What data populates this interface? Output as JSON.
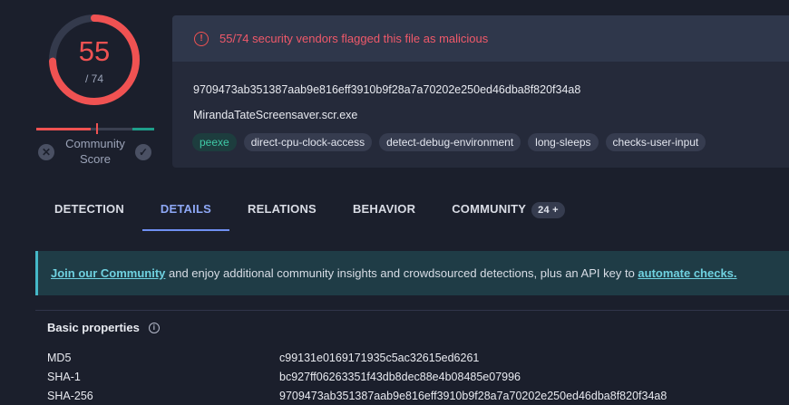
{
  "score": {
    "detections": "55",
    "total": "/ 74",
    "community_label": "Community Score"
  },
  "alert": {
    "text": "55/74 security vendors flagged this file as malicious"
  },
  "file": {
    "hash": "9709473ab351387aab9e816eff3910b9f28a7a70202e250ed46dba8f820f34a8",
    "name": "MirandaTateScreensaver.scr.exe",
    "tags": [
      "peexe",
      "direct-cpu-clock-access",
      "detect-debug-environment",
      "long-sleeps",
      "checks-user-input"
    ]
  },
  "tabs": [
    {
      "label": "DETECTION"
    },
    {
      "label": "DETAILS"
    },
    {
      "label": "RELATIONS"
    },
    {
      "label": "BEHAVIOR"
    },
    {
      "label": "COMMUNITY"
    }
  ],
  "community_badge": "24 +",
  "banner": {
    "link1": "Join our Community",
    "middle": " and enjoy additional community insights and crowdsourced detections, plus an API key to ",
    "link2": "automate checks."
  },
  "basic_properties": {
    "title": "Basic properties",
    "rows": [
      {
        "key": "MD5",
        "value": "c99131e0169171935c5ac32615ed6261"
      },
      {
        "key": "SHA-1",
        "value": "bc927ff06263351f43db8dec88e4b08485e07996"
      },
      {
        "key": "SHA-256",
        "value": "9709473ab351387aab9e816eff3910b9f28a7a70202e250ed46dba8f820f34a8"
      }
    ]
  },
  "colors": {
    "malicious": "#f05252",
    "accent": "#6f8ff2",
    "banner_link": "#6fd1e0"
  }
}
